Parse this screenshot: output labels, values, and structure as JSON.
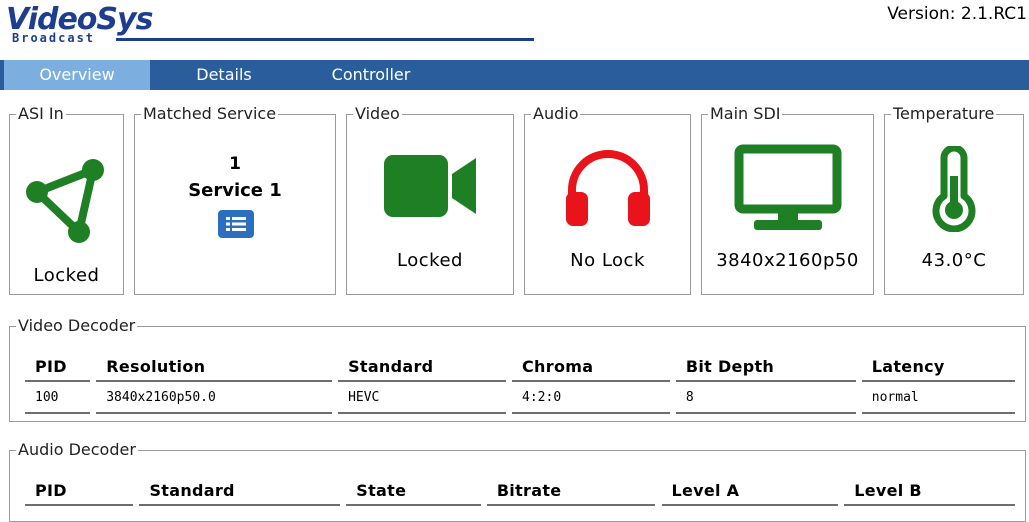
{
  "header": {
    "logo_main": "VideoSys",
    "logo_sub": "Broadcast",
    "version": "Version: 2.1.RC1"
  },
  "nav": {
    "tabs": [
      {
        "label": "Overview",
        "active": true
      },
      {
        "label": "Details",
        "active": false
      },
      {
        "label": "Controller",
        "active": false
      }
    ]
  },
  "status": {
    "asi_in": {
      "title": "ASI In",
      "value": "Locked",
      "icon": "network-icon",
      "color": "#1e7f24"
    },
    "matched_service": {
      "title": "Matched Service",
      "number": "1",
      "name": "Service 1",
      "icon": "list-icon",
      "color": "#2c6fc0"
    },
    "video": {
      "title": "Video",
      "value": "Locked",
      "icon": "video-camera-icon",
      "color": "#1e7f24"
    },
    "audio": {
      "title": "Audio",
      "value": "No Lock",
      "icon": "headphones-icon",
      "color": "#e8131b"
    },
    "main_sdi": {
      "title": "Main SDI",
      "value": "3840x2160p50",
      "icon": "monitor-icon",
      "color": "#1e7f24"
    },
    "temperature": {
      "title": "Temperature",
      "value": "43.0°C",
      "icon": "thermometer-icon",
      "color": "#1e7f24"
    }
  },
  "video_decoder": {
    "title": "Video Decoder",
    "columns": [
      "PID",
      "Resolution",
      "Standard",
      "Chroma",
      "Bit Depth",
      "Latency"
    ],
    "rows": [
      [
        "100",
        "3840x2160p50.0",
        "HEVC",
        "4:2:0",
        "8",
        "normal"
      ]
    ]
  },
  "audio_decoder": {
    "title": "Audio Decoder",
    "columns": [
      "PID",
      "Standard",
      "State",
      "Bitrate",
      "Level A",
      "Level B"
    ]
  }
}
